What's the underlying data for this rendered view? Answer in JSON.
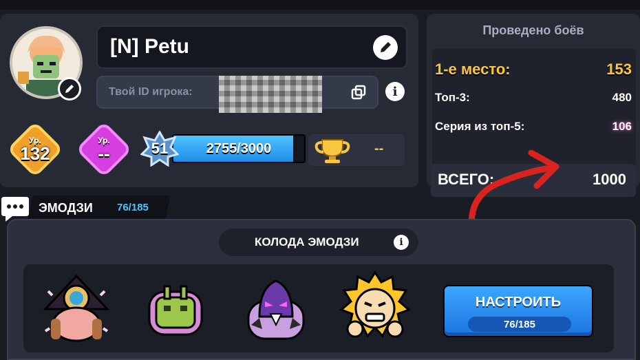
{
  "profile": {
    "name": "[N] Petu",
    "player_id_label": "Твой ID игрока:",
    "level_label": "Ур.",
    "level_value": "132",
    "level2_label": "Ур.",
    "level2_value": "--",
    "rank_value": "51",
    "xp_text": "2755/3000",
    "xp_progress": 0.918,
    "trophy_value": "--"
  },
  "stats": {
    "title": "Проведено боёв",
    "first_place_label": "1-е место:",
    "first_place_value": "153",
    "top3_label": "Топ-3:",
    "top3_value": "480",
    "top5_label": "Серия из топ-5:",
    "top5_value": "106",
    "total_label": "ВСЕГО:",
    "total_value": "1000"
  },
  "emoji": {
    "tab_label": "ЭМОДЗИ",
    "tab_count": "76/185",
    "deck_title": "КОЛОДА ЭМОДЗИ",
    "setup_label": "НАСТРОИТЬ",
    "setup_count": "76/185",
    "slots": [
      "wizard-emoji-icon",
      "robot-emoji-icon",
      "demon-emoji-icon",
      "angry-emoji-icon"
    ]
  },
  "colors": {
    "gold": "#f8c640",
    "accent_blue": "#3ba6ff",
    "annotation_red": "#d8231f"
  }
}
